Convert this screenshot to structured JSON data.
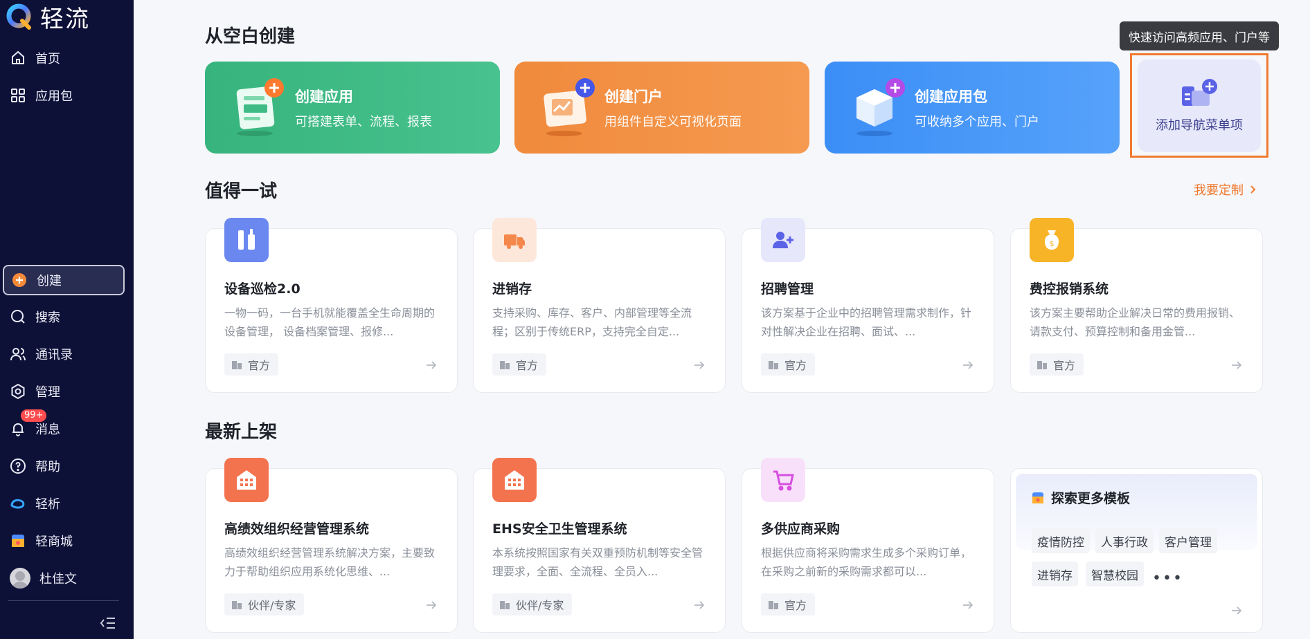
{
  "sidebar": {
    "brand": "轻流",
    "items": [
      {
        "label": "首页"
      },
      {
        "label": "应用包"
      },
      {
        "label": "创建"
      },
      {
        "label": "搜索"
      },
      {
        "label": "通讯录"
      },
      {
        "label": "管理"
      },
      {
        "label": "消息",
        "badge": "99+"
      },
      {
        "label": "帮助"
      },
      {
        "label": "轻析"
      },
      {
        "label": "轻商城"
      },
      {
        "label": "杜佳文"
      }
    ]
  },
  "blank_section": {
    "title": "从空白创建",
    "cards": [
      {
        "title": "创建应用",
        "subtitle": "可搭建表单、流程、报表"
      },
      {
        "title": "创建门户",
        "subtitle": "用组件自定义可视化页面"
      },
      {
        "title": "创建应用包",
        "subtitle": "可收纳多个应用、门户"
      }
    ],
    "nav_add": {
      "label": "添加导航菜单项"
    },
    "tooltip": "快速访问高频应用、门户等"
  },
  "try_section": {
    "title": "值得一试",
    "more_link": "我要定制",
    "cards": [
      {
        "name": "设备巡检2.0",
        "desc": "一物一码，一台手机就能覆盖全生命周期的设备管理， 设备档案管理、报修...",
        "tag": "官方"
      },
      {
        "name": "进销存",
        "desc": "支持采购、库存、客户、内部管理等全流程；区别于传统ERP，支持完全自定...",
        "tag": "官方"
      },
      {
        "name": "招聘管理",
        "desc": "该方案基于企业中的招聘管理需求制作，针对性解决企业在招聘、面试、...",
        "tag": "官方"
      },
      {
        "name": "费控报销系统",
        "desc": "该方案主要帮助企业解决日常的费用报销、请款支付、预算控制和备用金管...",
        "tag": "官方"
      }
    ]
  },
  "new_section": {
    "title": "最新上架",
    "cards": [
      {
        "name": "高绩效组织经营管理系统",
        "desc": "高绩效组织经营管理系统解决方案，主要致力于帮助组织应用系统化思维、...",
        "tag": "伙伴/专家"
      },
      {
        "name": "EHS安全卫生管理系统",
        "desc": "本系统按照国家有关双重预防机制等安全管理要求，全面、全流程、全员入...",
        "tag": "伙伴/专家"
      },
      {
        "name": "多供应商采购",
        "desc": "根据供应商将采购需求生成多个采购订单，在采购之前新的采购需求都可以...",
        "tag": "官方"
      }
    ],
    "explore": {
      "title": "探索更多模板",
      "chips": [
        "疫情防控",
        "人事行政",
        "客户管理",
        "进销存",
        "智慧校园"
      ],
      "more": "•••"
    }
  },
  "colors": {
    "sidebar_bg": "#0e1137",
    "green": "#3fbb85",
    "orange": "#f2903f",
    "blue": "#4595f8",
    "accent_orange": "#f07a2f"
  }
}
